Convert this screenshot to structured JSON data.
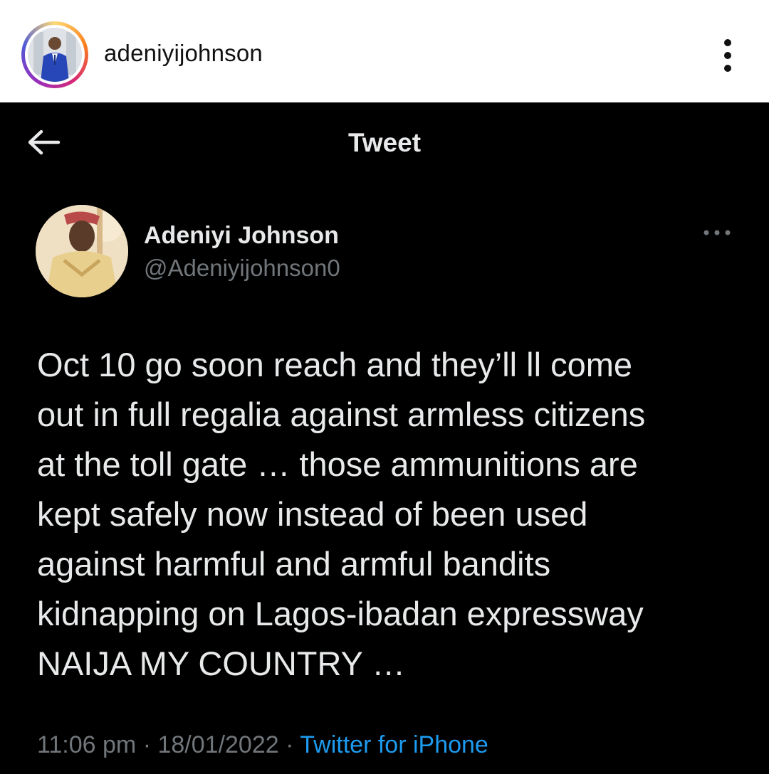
{
  "instagram": {
    "username": "adeniyijohnson"
  },
  "tweet_screen": {
    "title": "Tweet",
    "author": {
      "name": "Adeniyi Johnson",
      "handle": "@Adeniyijohnson0"
    },
    "text": "Oct 10 go soon reach and they’ll ll come\nout in full regalia against armless citizens\nat the toll gate … those ammunitions are\nkept safely now instead of been used\nagainst harmful and armful bandits\nkidnapping on Lagos-ibadan expressway\nNAIJA MY COUNTRY …",
    "time": "11:06 pm",
    "separator": "·",
    "date": "18/01/2022",
    "source": "Twitter for iPhone"
  },
  "icons": {
    "ig_more": "vertical-ellipsis-icon",
    "back": "back-arrow-icon",
    "tweet_more": "horizontal-ellipsis-icon"
  },
  "colors": {
    "background": "#000000",
    "text_primary": "#e7e9ea",
    "text_secondary": "#71767b",
    "link": "#1d9bf0",
    "ig_header_bg": "#ffffff"
  }
}
